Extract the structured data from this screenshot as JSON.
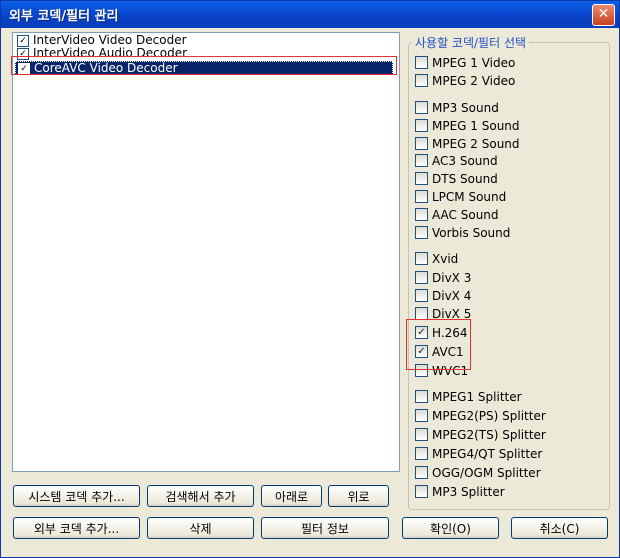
{
  "window": {
    "title": "외부 코덱/필터 관리",
    "close_glyph": "✕"
  },
  "filter_list": {
    "items": [
      {
        "label": "InterVideo Video Decoder",
        "checked": true,
        "selected": false
      },
      {
        "label": "InterVideo Audio Decoder",
        "checked": true,
        "selected": false
      },
      {
        "label": "CoreAVC Video Decoder",
        "checked": true,
        "selected": true
      }
    ]
  },
  "codec_group": {
    "title": "사용할 코덱/필터 선택",
    "options": [
      {
        "label": "MPEG 1 Video",
        "checked": false
      },
      {
        "label": "MPEG 2 Video",
        "checked": false
      },
      {
        "label": "MP3 Sound",
        "checked": false
      },
      {
        "label": "MPEG 1 Sound",
        "checked": false
      },
      {
        "label": "MPEG 2 Sound",
        "checked": false
      },
      {
        "label": "AC3 Sound",
        "checked": false
      },
      {
        "label": "DTS Sound",
        "checked": false
      },
      {
        "label": "LPCM Sound",
        "checked": false
      },
      {
        "label": "AAC Sound",
        "checked": false
      },
      {
        "label": "Vorbis Sound",
        "checked": false
      },
      {
        "label": "Xvid",
        "checked": false
      },
      {
        "label": "DivX 3",
        "checked": false
      },
      {
        "label": "DivX 4",
        "checked": false
      },
      {
        "label": "DivX 5",
        "checked": false
      },
      {
        "label": "H.264",
        "checked": true
      },
      {
        "label": "AVC1",
        "checked": true
      },
      {
        "label": "WVC1",
        "checked": false
      },
      {
        "label": "MPEG1 Splitter",
        "checked": false
      },
      {
        "label": "MPEG2(PS) Splitter",
        "checked": false
      },
      {
        "label": "MPEG2(TS) Splitter",
        "checked": false
      },
      {
        "label": "MPEG4/QT Splitter",
        "checked": false
      },
      {
        "label": "OGG/OGM Splitter",
        "checked": false
      },
      {
        "label": "MP3 Splitter",
        "checked": false
      }
    ]
  },
  "buttons": {
    "add_system_codec": "시스템 코덱 추가...",
    "search_add": "검색해서 추가",
    "down": "아래로",
    "up": "위로",
    "add_external_codec": "외부 코덱 추가...",
    "delete": "삭제",
    "filter_info": "필터 정보",
    "ok": "확인(O)",
    "cancel": "취소(C)"
  }
}
